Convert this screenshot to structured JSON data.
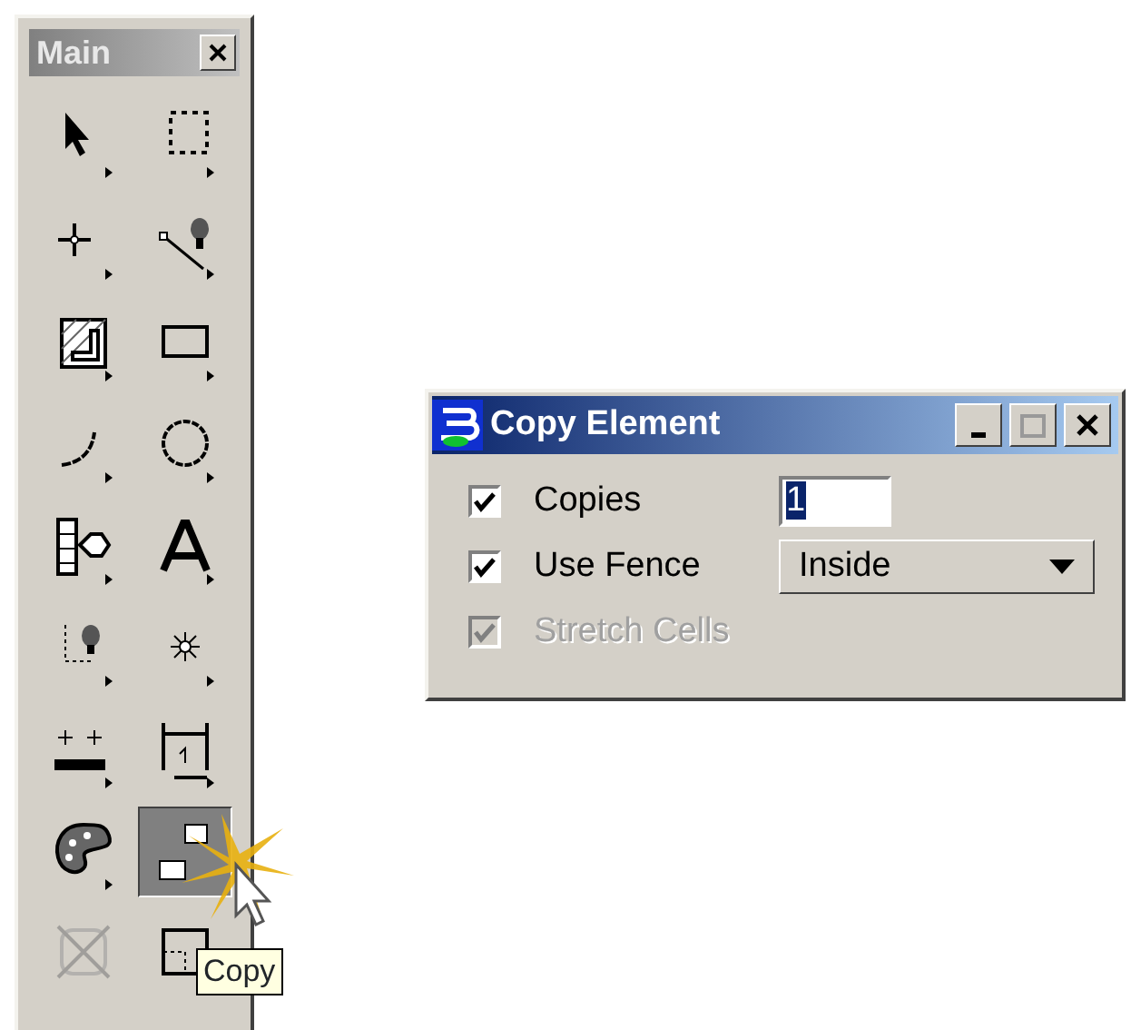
{
  "palette": {
    "title": "Main",
    "tools": [
      {
        "kind": "select",
        "selected": false,
        "disabled": false
      },
      {
        "kind": "fence",
        "selected": false,
        "disabled": false
      },
      {
        "kind": "point",
        "selected": false,
        "disabled": false
      },
      {
        "kind": "line-bulb",
        "selected": false,
        "disabled": false
      },
      {
        "kind": "hatch",
        "selected": false,
        "disabled": false
      },
      {
        "kind": "rectangle",
        "selected": false,
        "disabled": false
      },
      {
        "kind": "arc",
        "selected": false,
        "disabled": false
      },
      {
        "kind": "circle",
        "selected": false,
        "disabled": false
      },
      {
        "kind": "tag",
        "selected": false,
        "disabled": false
      },
      {
        "kind": "text",
        "selected": false,
        "disabled": false
      },
      {
        "kind": "snap-bulb",
        "selected": false,
        "disabled": false
      },
      {
        "kind": "snap",
        "selected": false,
        "disabled": false
      },
      {
        "kind": "measure",
        "selected": false,
        "disabled": false
      },
      {
        "kind": "dimension",
        "selected": false,
        "disabled": false
      },
      {
        "kind": "palette",
        "selected": false,
        "disabled": false
      },
      {
        "kind": "copy",
        "selected": true,
        "disabled": false
      },
      {
        "kind": "delete",
        "selected": false,
        "disabled": true
      },
      {
        "kind": "fence-box",
        "selected": false,
        "disabled": false
      }
    ],
    "tooltip": "Copy"
  },
  "dialog": {
    "title": "Copy Element",
    "options": [
      {
        "kind": "number",
        "label": "Copies",
        "checked": true,
        "disabled": false,
        "value": "1",
        "highlighted": true
      },
      {
        "kind": "dropdown",
        "label": "Use Fence",
        "checked": true,
        "disabled": false,
        "value": "Inside"
      },
      {
        "kind": "plain",
        "label": "Stretch Cells",
        "checked": true,
        "disabled": true
      }
    ]
  }
}
